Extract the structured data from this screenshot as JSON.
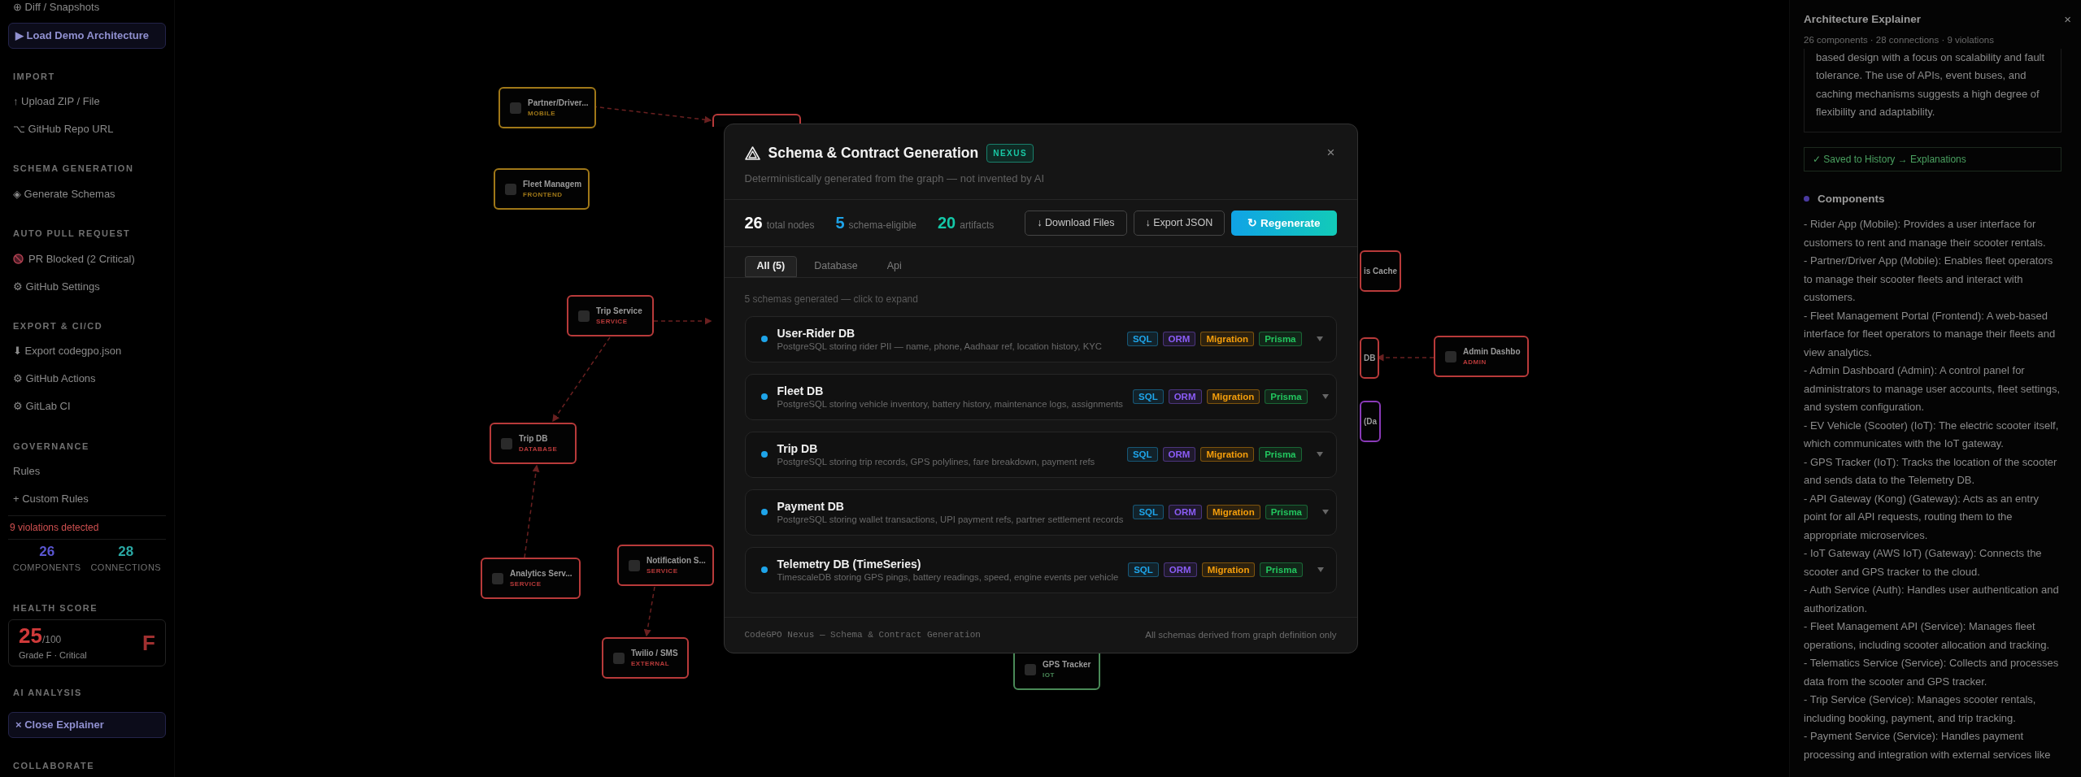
{
  "sidebar": {
    "items": [
      {
        "kind": "link",
        "label": "⊕ Diff / Snapshots"
      },
      {
        "kind": "button",
        "label": "▶ Load Demo Architecture"
      },
      {
        "kind": "heading",
        "label": "IMPORT"
      },
      {
        "kind": "link",
        "label": "↑ Upload ZIP / File"
      },
      {
        "kind": "link",
        "label": "⌥ GitHub Repo URL"
      },
      {
        "kind": "heading",
        "label": "SCHEMA GENERATION"
      },
      {
        "kind": "link",
        "label": "◈ Generate Schemas"
      },
      {
        "kind": "heading",
        "label": "AUTO PULL REQUEST"
      },
      {
        "kind": "blocked",
        "label": "PR Blocked (2 Critical)"
      },
      {
        "kind": "link",
        "label": "⚙ GitHub Settings"
      },
      {
        "kind": "heading",
        "label": "EXPORT & CI/CD"
      },
      {
        "kind": "link",
        "label": "⬇ Export codegpo.json"
      },
      {
        "kind": "link",
        "label": "⚙ GitHub Actions"
      },
      {
        "kind": "link",
        "label": "⚙ GitLab CI"
      },
      {
        "kind": "heading",
        "label": "GOVERNANCE"
      },
      {
        "kind": "link",
        "label": "Rules"
      },
      {
        "kind": "link",
        "label": "+ Custom Rules"
      },
      {
        "kind": "alert",
        "label": "9 violations detected"
      },
      {
        "kind": "stats",
        "stats": [
          {
            "value": "26",
            "label": "COMPONENTS",
            "color": "#5a56d0"
          },
          {
            "value": "28",
            "label": "CONNECTIONS",
            "color": "#2aa8a4"
          }
        ]
      },
      {
        "kind": "heading",
        "label": "HEALTH SCORE"
      },
      {
        "kind": "score",
        "score": "25",
        "max": "/100",
        "caption": "Grade F · Critical",
        "grade": "F"
      },
      {
        "kind": "heading",
        "label": "AI ANALYSIS"
      },
      {
        "kind": "button",
        "label": "× Close Explainer"
      },
      {
        "kind": "heading",
        "label": "COLLABORATE"
      }
    ]
  },
  "canvas": {
    "nodes": [
      {
        "label": "Partner/Driver...",
        "type": "MOBILE",
        "color": "#a07818"
      },
      {
        "label": "Fleet Managem",
        "type": "FRONTEND",
        "color": "#a07818"
      },
      {
        "label": "Trip Service",
        "type": "SERVICE",
        "color": "#b83a3a"
      },
      {
        "label": "Trip DB",
        "type": "DATABASE",
        "color": "#b83a3a"
      },
      {
        "label": "Analytics Serv...",
        "type": "SERVICE",
        "color": "#b83a3a"
      },
      {
        "label": "Notification S...",
        "type": "SERVICE",
        "color": "#b83a3a"
      },
      {
        "label": "Twilio / SMS",
        "type": "EXTERNAL",
        "color": "#b83a3a"
      },
      {
        "label": "GPS Tracker",
        "type": "IOT",
        "color": "#4a8a58"
      },
      {
        "label": "Admin Dashbo",
        "type": "ADMIN",
        "color": "#b83a3a"
      },
      {
        "color": "#b83a3a"
      },
      {
        "label": "is Cache",
        "color": "#b83a3a"
      },
      {
        "label": "DB",
        "color": "#b83a3a"
      },
      {
        "label": "(Da",
        "color": "#8a3ab8"
      }
    ]
  },
  "explainer": {
    "title": "Architecture Explainer",
    "close": "×",
    "subtitle": "26 components · 28 connections · 9 violations",
    "summary": "based design with a focus on scalability and fault tolerance. The use of APIs, event buses, and caching mechanisms suggests a high degree of flexibility and adaptability.",
    "saved": "✓ Saved to History → Explanations",
    "section": {
      "title": "Components",
      "color": "#4a3aa0"
    },
    "lines": [
      "- Rider App (Mobile): Provides a user interface for customers to rent and manage their scooter rentals.",
      "- Partner/Driver App (Mobile): Enables fleet operators to manage their scooter fleets and interact with customers.",
      "- Fleet Management Portal (Frontend): A web-based interface for fleet operators to manage their fleets and view analytics.",
      "- Admin Dashboard (Admin): A control panel for administrators to manage user accounts, fleet settings, and system configuration.",
      "- EV Vehicle (Scooter) (IoT): The electric scooter itself, which communicates with the IoT gateway.",
      "- GPS Tracker (IoT): Tracks the location of the scooter and sends data to the Telemetry DB.",
      "- API Gateway (Kong) (Gateway): Acts as an entry point for all API requests, routing them to the appropriate microservices.",
      "- IoT Gateway (AWS IoT) (Gateway): Connects the scooter and GPS tracker to the cloud.",
      "- Auth Service (Auth): Handles user authentication and authorization.",
      "- Fleet Management API (Service): Manages fleet operations, including scooter allocation and tracking.",
      "- Telematics Service (Service): Collects and processes data from the scooter and GPS tracker.",
      "- Trip Service (Service): Manages scooter rentals, including booking, payment, and trip tracking.",
      "- Payment Service (Service): Handles payment processing and integration with external services like"
    ]
  },
  "modal": {
    "title": "Schema & Contract Generation",
    "badge": "NEXUS",
    "close": "×",
    "subtitle": "Deterministically generated from the graph — not invented by AI",
    "stats": [
      {
        "value": "26",
        "label": "total nodes",
        "color": "#ffffff"
      },
      {
        "value": "5",
        "label": "schema-eligible",
        "color": "#1ea4e9"
      },
      {
        "value": "20",
        "label": "artifacts",
        "color": "#14c8a8"
      }
    ],
    "actions": [
      {
        "kind": "outline",
        "label": "↓ Download Files"
      },
      {
        "kind": "outline",
        "label": "↓ Export JSON"
      },
      {
        "kind": "primary",
        "label": "↻ Regenerate"
      }
    ],
    "tabs": [
      {
        "label": "All (5)",
        "selected": true
      },
      {
        "label": "Database",
        "selected": false
      },
      {
        "label": "Api",
        "selected": false
      }
    ],
    "hint": "5 schemas generated — click to expand",
    "schemas": [
      {
        "name": "User-Rider DB",
        "description": "PostgreSQL storing rider PII — name, phone, Aadhaar ref, location history, KYC",
        "color": "#1ea4e9",
        "expanded": false,
        "tags": [
          {
            "label": "SQL",
            "color": "#1ea4e9"
          },
          {
            "label": "ORM",
            "color": "#8b5cf6"
          },
          {
            "label": "Migration",
            "color": "#f59e0b"
          },
          {
            "label": "Prisma",
            "color": "#22c55e"
          }
        ]
      },
      {
        "name": "Fleet DB",
        "description": "PostgreSQL storing vehicle inventory, battery history, maintenance logs, assignments",
        "color": "#1ea4e9",
        "expanded": false,
        "tags": [
          {
            "label": "SQL",
            "color": "#1ea4e9"
          },
          {
            "label": "ORM",
            "color": "#8b5cf6"
          },
          {
            "label": "Migration",
            "color": "#f59e0b"
          },
          {
            "label": "Prisma",
            "color": "#22c55e"
          }
        ]
      },
      {
        "name": "Trip DB",
        "description": "PostgreSQL storing trip records, GPS polylines, fare breakdown, payment refs",
        "color": "#1ea4e9",
        "expanded": false,
        "tags": [
          {
            "label": "SQL",
            "color": "#1ea4e9"
          },
          {
            "label": "ORM",
            "color": "#8b5cf6"
          },
          {
            "label": "Migration",
            "color": "#f59e0b"
          },
          {
            "label": "Prisma",
            "color": "#22c55e"
          }
        ]
      },
      {
        "name": "Payment DB",
        "description": "PostgreSQL storing wallet transactions, UPI payment refs, partner settlement records",
        "color": "#1ea4e9",
        "expanded": false,
        "tags": [
          {
            "label": "SQL",
            "color": "#1ea4e9"
          },
          {
            "label": "ORM",
            "color": "#8b5cf6"
          },
          {
            "label": "Migration",
            "color": "#f59e0b"
          },
          {
            "label": "Prisma",
            "color": "#22c55e"
          }
        ]
      },
      {
        "name": "Telemetry DB (TimeSeries)",
        "description": "TimescaleDB storing GPS pings, battery readings, speed, engine events per vehicle",
        "color": "#1ea4e9",
        "expanded": false,
        "tags": [
          {
            "label": "SQL",
            "color": "#1ea4e9"
          },
          {
            "label": "ORM",
            "color": "#8b5cf6"
          },
          {
            "label": "Migration",
            "color": "#f59e0b"
          },
          {
            "label": "Prisma",
            "color": "#22c55e"
          }
        ]
      }
    ],
    "footer_left": "CodeGPO Nexus — Schema & Contract Generation",
    "footer_right": "All schemas derived from graph definition only"
  }
}
